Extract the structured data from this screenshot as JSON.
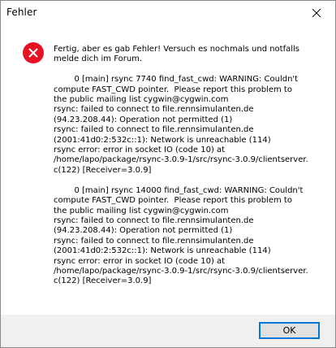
{
  "window": {
    "title": "Fehler",
    "close_icon": "close-icon"
  },
  "dialog": {
    "icon": "error-icon",
    "icon_color": "#e81123",
    "message": "Fertig, aber es gab Fehler! Versuch es nochmals und notfalls\nmelde dich im Forum.\n\n        0 [main] rsync 7740 find_fast_cwd: WARNING: Couldn't\ncompute FAST_CWD pointer.  Please report this problem to\nthe public mailing list cygwin@cygwin.com\nrsync: failed to connect to file.rennsimulanten.de\n(94.23.208.44): Operation not permitted (1)\nrsync: failed to connect to file.rennsimulanten.de\n(2001:41d0:2:532c::1): Network is unreachable (114)\nrsync error: error in socket IO (code 10) at\n/home/lapo/package/rsync-3.0.9-1/src/rsync-3.0.9/clientserver.\nc(122) [Receiver=3.0.9]\n\n        0 [main] rsync 14000 find_fast_cwd: WARNING: Couldn't\ncompute FAST_CWD pointer.  Please report this problem to\nthe public mailing list cygwin@cygwin.com\nrsync: failed to connect to file.rennsimulanten.de\n(94.23.208.44): Operation not permitted (1)\nrsync: failed to connect to file.rennsimulanten.de\n(2001:41d0:2:532c::1): Network is unreachable (114)\nrsync error: error in socket IO (code 10) at\n/home/lapo/package/rsync-3.0.9-1/src/rsync-3.0.9/clientserver.\nc(122) [Receiver=3.0.9]"
  },
  "buttons": {
    "ok_label": "OK",
    "ok_accent": "#0078d7"
  }
}
